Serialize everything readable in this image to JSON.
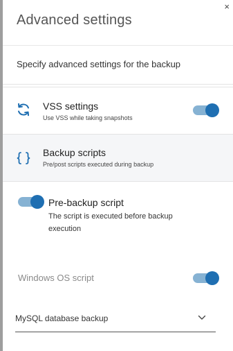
{
  "dialog": {
    "title": "Advanced settings",
    "close_glyph": "×",
    "subtitle": "Specify advanced settings for the backup"
  },
  "vss": {
    "title": "VSS settings",
    "description": "Use VSS while taking snapshots",
    "icon": "sync-icon",
    "enabled": true
  },
  "backup_scripts": {
    "title": "Backup scripts",
    "description": "Pre/post scripts executed during backup",
    "icon": "braces-icon"
  },
  "pre_backup": {
    "title": "Pre-backup script",
    "description": "The script is executed before backup execution",
    "enabled": true
  },
  "windows_script": {
    "label": "Windows OS script",
    "enabled": true
  },
  "script_select": {
    "value": "MySQL database backup"
  },
  "colors": {
    "accent": "#1f6fb2",
    "track": "#86b2d3",
    "selected_row_bg": "#f5f6f8"
  }
}
